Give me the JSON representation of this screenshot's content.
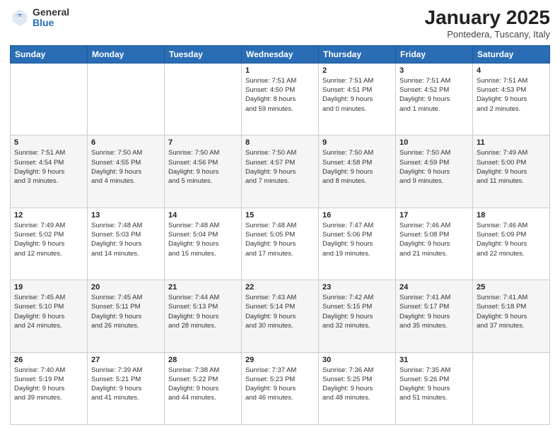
{
  "logo": {
    "general": "General",
    "blue": "Blue"
  },
  "title": "January 2025",
  "location": "Pontedera, Tuscany, Italy",
  "days_of_week": [
    "Sunday",
    "Monday",
    "Tuesday",
    "Wednesday",
    "Thursday",
    "Friday",
    "Saturday"
  ],
  "weeks": [
    [
      {
        "day": "",
        "info": ""
      },
      {
        "day": "",
        "info": ""
      },
      {
        "day": "",
        "info": ""
      },
      {
        "day": "1",
        "info": "Sunrise: 7:51 AM\nSunset: 4:50 PM\nDaylight: 8 hours\nand 59 minutes."
      },
      {
        "day": "2",
        "info": "Sunrise: 7:51 AM\nSunset: 4:51 PM\nDaylight: 9 hours\nand 0 minutes."
      },
      {
        "day": "3",
        "info": "Sunrise: 7:51 AM\nSunset: 4:52 PM\nDaylight: 9 hours\nand 1 minute."
      },
      {
        "day": "4",
        "info": "Sunrise: 7:51 AM\nSunset: 4:53 PM\nDaylight: 9 hours\nand 2 minutes."
      }
    ],
    [
      {
        "day": "5",
        "info": "Sunrise: 7:51 AM\nSunset: 4:54 PM\nDaylight: 9 hours\nand 3 minutes."
      },
      {
        "day": "6",
        "info": "Sunrise: 7:50 AM\nSunset: 4:55 PM\nDaylight: 9 hours\nand 4 minutes."
      },
      {
        "day": "7",
        "info": "Sunrise: 7:50 AM\nSunset: 4:56 PM\nDaylight: 9 hours\nand 5 minutes."
      },
      {
        "day": "8",
        "info": "Sunrise: 7:50 AM\nSunset: 4:57 PM\nDaylight: 9 hours\nand 7 minutes."
      },
      {
        "day": "9",
        "info": "Sunrise: 7:50 AM\nSunset: 4:58 PM\nDaylight: 9 hours\nand 8 minutes."
      },
      {
        "day": "10",
        "info": "Sunrise: 7:50 AM\nSunset: 4:59 PM\nDaylight: 9 hours\nand 9 minutes."
      },
      {
        "day": "11",
        "info": "Sunrise: 7:49 AM\nSunset: 5:00 PM\nDaylight: 9 hours\nand 11 minutes."
      }
    ],
    [
      {
        "day": "12",
        "info": "Sunrise: 7:49 AM\nSunset: 5:02 PM\nDaylight: 9 hours\nand 12 minutes."
      },
      {
        "day": "13",
        "info": "Sunrise: 7:48 AM\nSunset: 5:03 PM\nDaylight: 9 hours\nand 14 minutes."
      },
      {
        "day": "14",
        "info": "Sunrise: 7:48 AM\nSunset: 5:04 PM\nDaylight: 9 hours\nand 15 minutes."
      },
      {
        "day": "15",
        "info": "Sunrise: 7:48 AM\nSunset: 5:05 PM\nDaylight: 9 hours\nand 17 minutes."
      },
      {
        "day": "16",
        "info": "Sunrise: 7:47 AM\nSunset: 5:06 PM\nDaylight: 9 hours\nand 19 minutes."
      },
      {
        "day": "17",
        "info": "Sunrise: 7:46 AM\nSunset: 5:08 PM\nDaylight: 9 hours\nand 21 minutes."
      },
      {
        "day": "18",
        "info": "Sunrise: 7:46 AM\nSunset: 5:09 PM\nDaylight: 9 hours\nand 22 minutes."
      }
    ],
    [
      {
        "day": "19",
        "info": "Sunrise: 7:45 AM\nSunset: 5:10 PM\nDaylight: 9 hours\nand 24 minutes."
      },
      {
        "day": "20",
        "info": "Sunrise: 7:45 AM\nSunset: 5:11 PM\nDaylight: 9 hours\nand 26 minutes."
      },
      {
        "day": "21",
        "info": "Sunrise: 7:44 AM\nSunset: 5:13 PM\nDaylight: 9 hours\nand 28 minutes."
      },
      {
        "day": "22",
        "info": "Sunrise: 7:43 AM\nSunset: 5:14 PM\nDaylight: 9 hours\nand 30 minutes."
      },
      {
        "day": "23",
        "info": "Sunrise: 7:42 AM\nSunset: 5:15 PM\nDaylight: 9 hours\nand 32 minutes."
      },
      {
        "day": "24",
        "info": "Sunrise: 7:41 AM\nSunset: 5:17 PM\nDaylight: 9 hours\nand 35 minutes."
      },
      {
        "day": "25",
        "info": "Sunrise: 7:41 AM\nSunset: 5:18 PM\nDaylight: 9 hours\nand 37 minutes."
      }
    ],
    [
      {
        "day": "26",
        "info": "Sunrise: 7:40 AM\nSunset: 5:19 PM\nDaylight: 9 hours\nand 39 minutes."
      },
      {
        "day": "27",
        "info": "Sunrise: 7:39 AM\nSunset: 5:21 PM\nDaylight: 9 hours\nand 41 minutes."
      },
      {
        "day": "28",
        "info": "Sunrise: 7:38 AM\nSunset: 5:22 PM\nDaylight: 9 hours\nand 44 minutes."
      },
      {
        "day": "29",
        "info": "Sunrise: 7:37 AM\nSunset: 5:23 PM\nDaylight: 9 hours\nand 46 minutes."
      },
      {
        "day": "30",
        "info": "Sunrise: 7:36 AM\nSunset: 5:25 PM\nDaylight: 9 hours\nand 48 minutes."
      },
      {
        "day": "31",
        "info": "Sunrise: 7:35 AM\nSunset: 5:26 PM\nDaylight: 9 hours\nand 51 minutes."
      },
      {
        "day": "",
        "info": ""
      }
    ]
  ]
}
